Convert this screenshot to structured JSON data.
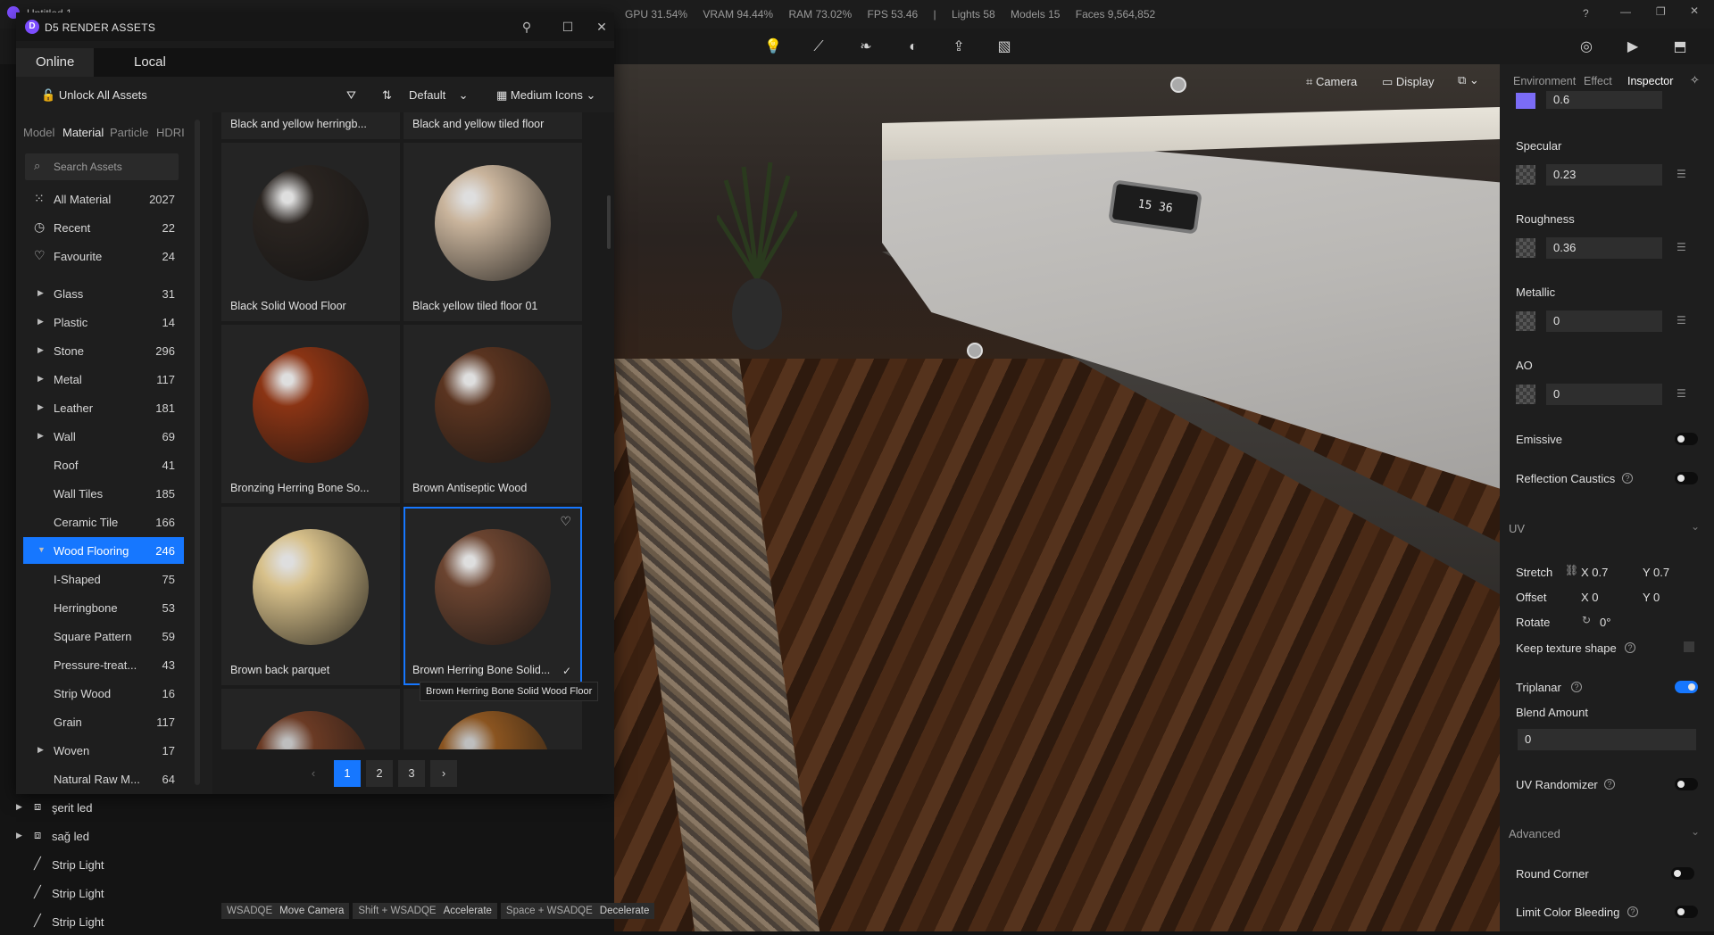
{
  "window_title": "Untitled 1",
  "stats": {
    "gpu": "GPU 31.54%",
    "vram": "VRAM 94.44%",
    "ram": "RAM 73.02%",
    "fps": "FPS 53.46",
    "lights": "Lights 58",
    "models": "Models 15",
    "faces": "Faces 9,564,852"
  },
  "viewport": {
    "camera": "Camera",
    "display": "Display",
    "clock": "15 36"
  },
  "assets": {
    "title": "D5 RENDER ASSETS",
    "tabs": [
      "Online",
      "Local"
    ],
    "unlock": "Unlock All Assets",
    "sort": "Default",
    "view": "Medium Icons",
    "cat_tabs": [
      "Model",
      "Material",
      "Particle",
      "HDRI"
    ],
    "search_placeholder": "Search Assets",
    "categories": [
      {
        "label": "All Material",
        "count": "2027",
        "icon": "grid-icon"
      },
      {
        "label": "Recent",
        "count": "22",
        "icon": "clock-icon"
      },
      {
        "label": "Favourite",
        "count": "24",
        "icon": "heart-icon"
      }
    ],
    "types": [
      {
        "label": "Glass",
        "count": "31",
        "arrow": true
      },
      {
        "label": "Plastic",
        "count": "14",
        "arrow": true
      },
      {
        "label": "Stone",
        "count": "296",
        "arrow": true
      },
      {
        "label": "Metal",
        "count": "117",
        "arrow": true
      },
      {
        "label": "Leather",
        "count": "181",
        "arrow": true
      },
      {
        "label": "Wall",
        "count": "69",
        "arrow": true
      },
      {
        "label": "Roof",
        "count": "41",
        "arrow": false
      },
      {
        "label": "Wall Tiles",
        "count": "185",
        "arrow": false
      },
      {
        "label": "Ceramic Tile",
        "count": "166",
        "arrow": false
      },
      {
        "label": "Wood Flooring",
        "count": "246",
        "arrow": true,
        "selected": true
      },
      {
        "label": "I-Shaped",
        "count": "75",
        "arrow": false
      },
      {
        "label": "Herringbone",
        "count": "53",
        "arrow": false
      },
      {
        "label": "Square Pattern",
        "count": "59",
        "arrow": false
      },
      {
        "label": "Pressure-treat...",
        "count": "43",
        "arrow": false
      },
      {
        "label": "Strip Wood",
        "count": "16",
        "arrow": false
      },
      {
        "label": "Grain",
        "count": "117",
        "arrow": false
      },
      {
        "label": "Woven",
        "count": "17",
        "arrow": true
      },
      {
        "label": "Natural Raw M...",
        "count": "64",
        "arrow": false
      }
    ],
    "top_row": [
      "Black and yellow herringb...",
      "Black and yellow tiled floor"
    ],
    "items": [
      {
        "name": "Black Solid Wood Floor",
        "color": "#2a2420"
      },
      {
        "name": "Black yellow tiled floor 01",
        "color": "#c9b49c"
      },
      {
        "name": "Bronzing Herring Bone So...",
        "color": "#8a3414"
      },
      {
        "name": "Brown Antiseptic Wood",
        "color": "#5a3420"
      },
      {
        "name": "Brown back parquet",
        "color": "#d7c08a"
      },
      {
        "name": "Brown Herring Bone Solid...",
        "color": "#6b4430"
      }
    ],
    "tooltip": "Brown Herring Bone Solid Wood Floor",
    "pages": [
      "1",
      "2",
      "3"
    ]
  },
  "scene_tree": [
    {
      "label": "şerit led",
      "icon": "light-strip-icon"
    },
    {
      "label": "sağ led",
      "icon": "light-strip-icon"
    },
    {
      "label": "Strip Light",
      "icon": "line-light-icon"
    },
    {
      "label": "Strip Light",
      "icon": "line-light-icon"
    },
    {
      "label": "Strip Light",
      "icon": "line-light-icon"
    }
  ],
  "hints": [
    {
      "key": "WSADQE",
      "action": "Move Camera"
    },
    {
      "key": "Shift + WSADQE",
      "action": "Accelerate"
    },
    {
      "key": "Space + WSADQE",
      "action": "Decelerate"
    }
  ],
  "inspector": {
    "tabs": [
      "Environment",
      "Effect",
      "Inspector"
    ],
    "top_value": "0.6",
    "specular": {
      "label": "Specular",
      "value": "0.23"
    },
    "roughness": {
      "label": "Roughness",
      "value": "0.36"
    },
    "metallic": {
      "label": "Metallic",
      "value": "0"
    },
    "ao": {
      "label": "AO",
      "value": "0"
    },
    "emissive": "Emissive",
    "caustics": "Reflection Caustics",
    "uv": "UV",
    "stretch": {
      "label": "Stretch",
      "x": "X 0.7",
      "y": "Y 0.7"
    },
    "offset": {
      "label": "Offset",
      "x": "X 0",
      "y": "Y 0"
    },
    "rotate": {
      "label": "Rotate",
      "value": "0°"
    },
    "keep_shape": "Keep texture shape",
    "triplanar": "Triplanar",
    "blend": {
      "label": "Blend Amount",
      "value": "0"
    },
    "uv_random": "UV Randomizer",
    "advanced": "Advanced",
    "round_corner": "Round Corner",
    "limit_bleed": "Limit Color Bleeding"
  }
}
